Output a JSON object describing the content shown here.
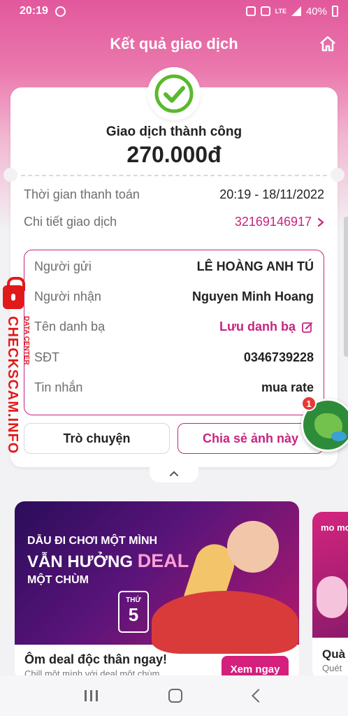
{
  "status_bar": {
    "time": "20:19",
    "battery": "40%",
    "network": "LTE",
    "icons": [
      "messenger-icon",
      "alarm-icon",
      "mute-icon",
      "signal-icon",
      "battery-icon"
    ]
  },
  "header": {
    "title": "Kết quả giao dịch",
    "home_icon": "home-icon"
  },
  "result": {
    "status": "Giao dịch thành công",
    "amount": "270.000đ",
    "status_icon": "check-circle-icon"
  },
  "details": {
    "time_label": "Thời gian thanh toán",
    "time_value": "20:19 - 18/11/2022",
    "txn_label": "Chi tiết giao dịch",
    "txn_value": "32169146917"
  },
  "info": {
    "sender_label": "Người gửi",
    "sender_value": "LÊ HOÀNG ANH TÚ",
    "receiver_label": "Người nhận",
    "receiver_value": "Nguyen Minh Hoang",
    "contact_label": "Tên danh bạ",
    "contact_value": "Lưu danh bạ",
    "phone_label": "SĐT",
    "phone_value": "0346739228",
    "message_label": "Tin nhắn",
    "message_value": "mua rate"
  },
  "actions": {
    "chat": "Trò chuyện",
    "share": "Chia sẻ ảnh này"
  },
  "watermark": {
    "main": "CHECKSCAM.INFO",
    "sub": "DATA CENTER"
  },
  "chathead": {
    "badge": "1"
  },
  "promo": {
    "art_line1": "DẪU ĐI CHƠI MỘT MÌNH",
    "art_line2": "VẪN HƯỞNG",
    "art_deal": "DEAL",
    "art_line3": "MỘT CHÙM",
    "art_day_label": "THỨ",
    "art_day_num": "5",
    "title": "Ôm deal độc thân ngay!",
    "subtitle": "Chill một mình với deal một chùm",
    "button": "Xem ngay"
  },
  "promo2": {
    "logo": "mo mo",
    "title": "Quà",
    "subtitle": "Quét"
  },
  "colors": {
    "brand": "#c6257f",
    "success": "#5cb82e",
    "watermark": "#e01a1a"
  }
}
